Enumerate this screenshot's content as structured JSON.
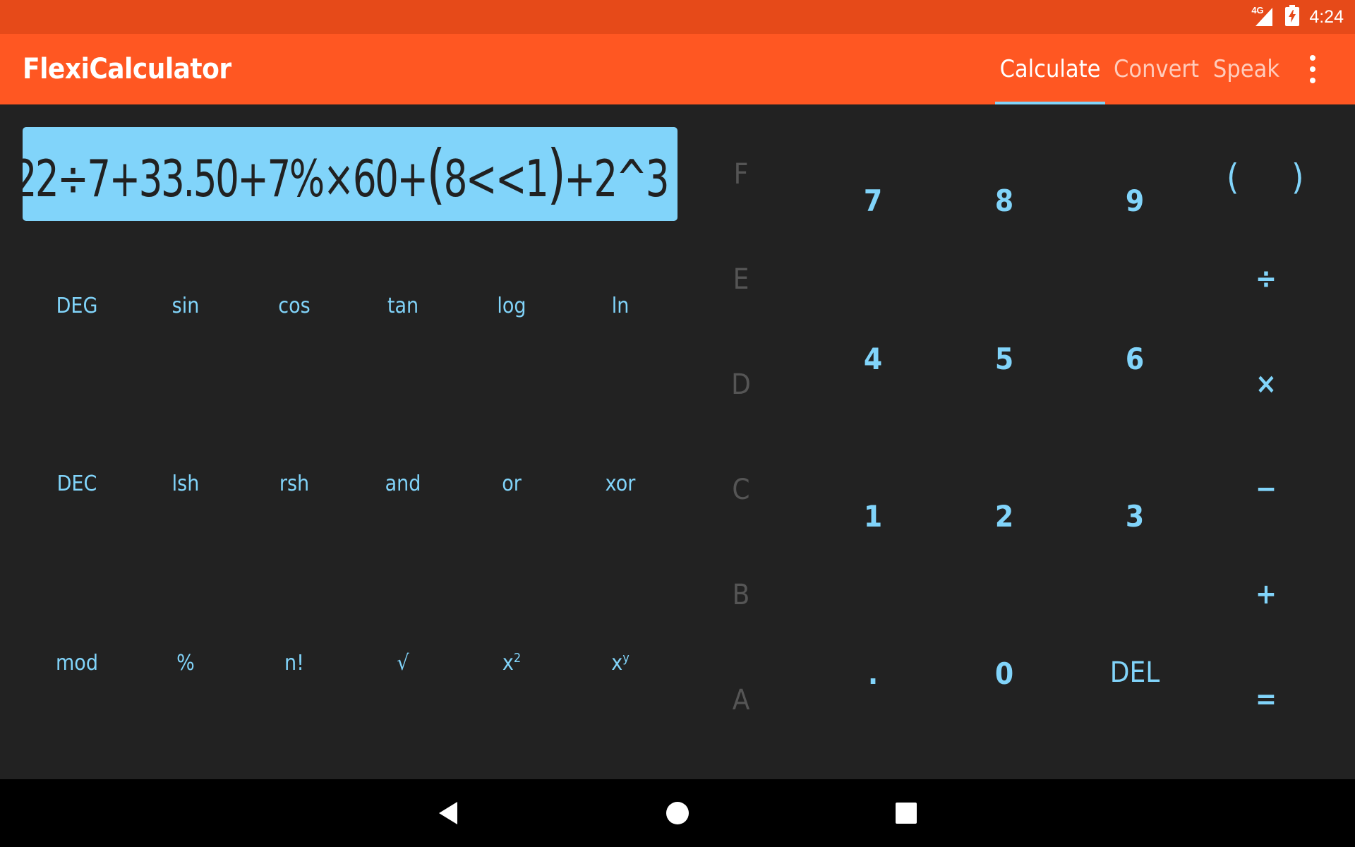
{
  "status_bar": {
    "network": "4G",
    "time": "4:24",
    "icons": [
      "signal-icon",
      "battery-charging-icon"
    ]
  },
  "app_bar": {
    "title": "FlexiCalculator",
    "tabs": [
      {
        "label": "Calculate",
        "active": true
      },
      {
        "label": "Convert",
        "active": false
      },
      {
        "label": "Speak",
        "active": false
      }
    ],
    "menu_icon": "more-vertical-icon"
  },
  "display": {
    "expr_before_paren": "22÷7+33.50+7%×60+",
    "open_paren": "(",
    "inner": "8<<1",
    "close_paren": ")",
    "expr_after_paren": "+2^3"
  },
  "scientific": [
    [
      "DEG",
      "sin",
      "cos",
      "tan",
      "log",
      "ln"
    ],
    [
      "DEC",
      "lsh",
      "rsh",
      "and",
      "or",
      "xor"
    ],
    [
      "mod",
      "%",
      "n!",
      "√"
    ]
  ],
  "power_keys": {
    "square_base": "x",
    "square_exp": "2",
    "power_base": "x",
    "power_exp": "y"
  },
  "hex_keys": [
    "F",
    "E",
    "D",
    "C",
    "B",
    "A"
  ],
  "number_pad": {
    "seven": "7",
    "eight": "8",
    "nine": "9",
    "four": "4",
    "five": "5",
    "six": "6",
    "one": "1",
    "two": "2",
    "three": "3",
    "dot": ".",
    "zero": "0",
    "delete": "DEL"
  },
  "operators": {
    "open_paren": "(",
    "close_paren": ")",
    "divide": "÷",
    "multiply": "×",
    "minus": "−",
    "plus": "+",
    "equals": "="
  },
  "colors": {
    "status_bar": "#E64A19",
    "app_bar": "#FF5722",
    "accent": "#81D4FA",
    "background": "#222222",
    "hex_disabled": "#555555"
  },
  "nav_bar": {
    "icons": [
      "back-icon",
      "home-icon",
      "recents-icon"
    ]
  }
}
